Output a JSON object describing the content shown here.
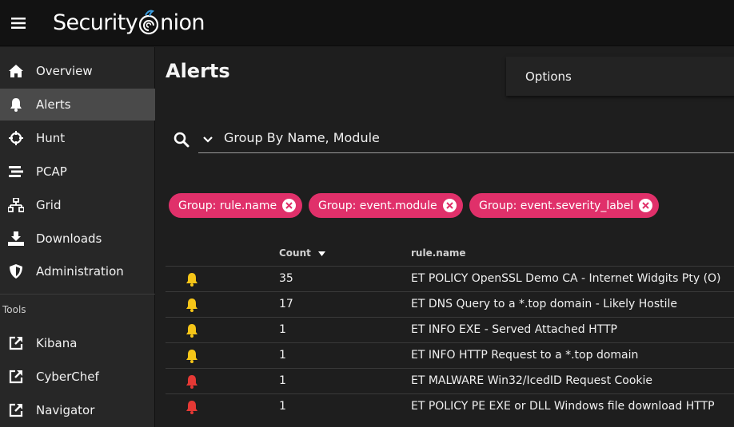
{
  "app": {
    "logo_text_1": "Security",
    "logo_text_2": "nion"
  },
  "sidebar": {
    "items": [
      {
        "label": "Overview",
        "icon": "home-icon"
      },
      {
        "label": "Alerts",
        "icon": "bell-icon",
        "active": true
      },
      {
        "label": "Hunt",
        "icon": "crosshairs-icon"
      },
      {
        "label": "PCAP",
        "icon": "stream-icon"
      },
      {
        "label": "Grid",
        "icon": "network-icon"
      },
      {
        "label": "Downloads",
        "icon": "download-icon"
      },
      {
        "label": "Administration",
        "icon": "shield-icon"
      }
    ],
    "tools_header": "Tools",
    "tools": [
      {
        "label": "Kibana",
        "icon": "external-link-icon"
      },
      {
        "label": "CyberChef",
        "icon": "external-link-icon"
      },
      {
        "label": "Navigator",
        "icon": "external-link-icon"
      }
    ]
  },
  "main": {
    "title": "Alerts",
    "options_label": "Options",
    "query": "Group By Name, Module",
    "chips": [
      {
        "label": "Group: rule.name"
      },
      {
        "label": "Group: event.module"
      },
      {
        "label": "Group: event.severity_label"
      }
    ],
    "table": {
      "headers": {
        "count": "Count",
        "rule_name": "rule.name"
      },
      "rows": [
        {
          "severity": "medium",
          "count": "35",
          "rule_name": "ET POLICY OpenSSL Demo CA - Internet Widgits Pty (O)"
        },
        {
          "severity": "medium",
          "count": "17",
          "rule_name": "ET DNS Query to a *.top domain - Likely Hostile"
        },
        {
          "severity": "medium",
          "count": "1",
          "rule_name": "ET INFO EXE - Served Attached HTTP"
        },
        {
          "severity": "medium",
          "count": "1",
          "rule_name": "ET INFO HTTP Request to a *.top domain"
        },
        {
          "severity": "high",
          "count": "1",
          "rule_name": "ET MALWARE Win32/IcedID Request Cookie"
        },
        {
          "severity": "high",
          "count": "1",
          "rule_name": "ET POLICY PE EXE or DLL Windows file download HTTP"
        }
      ]
    }
  },
  "colors": {
    "accent": "#e0306a",
    "severity_medium": "#f5c518",
    "severity_high": "#e53935"
  }
}
